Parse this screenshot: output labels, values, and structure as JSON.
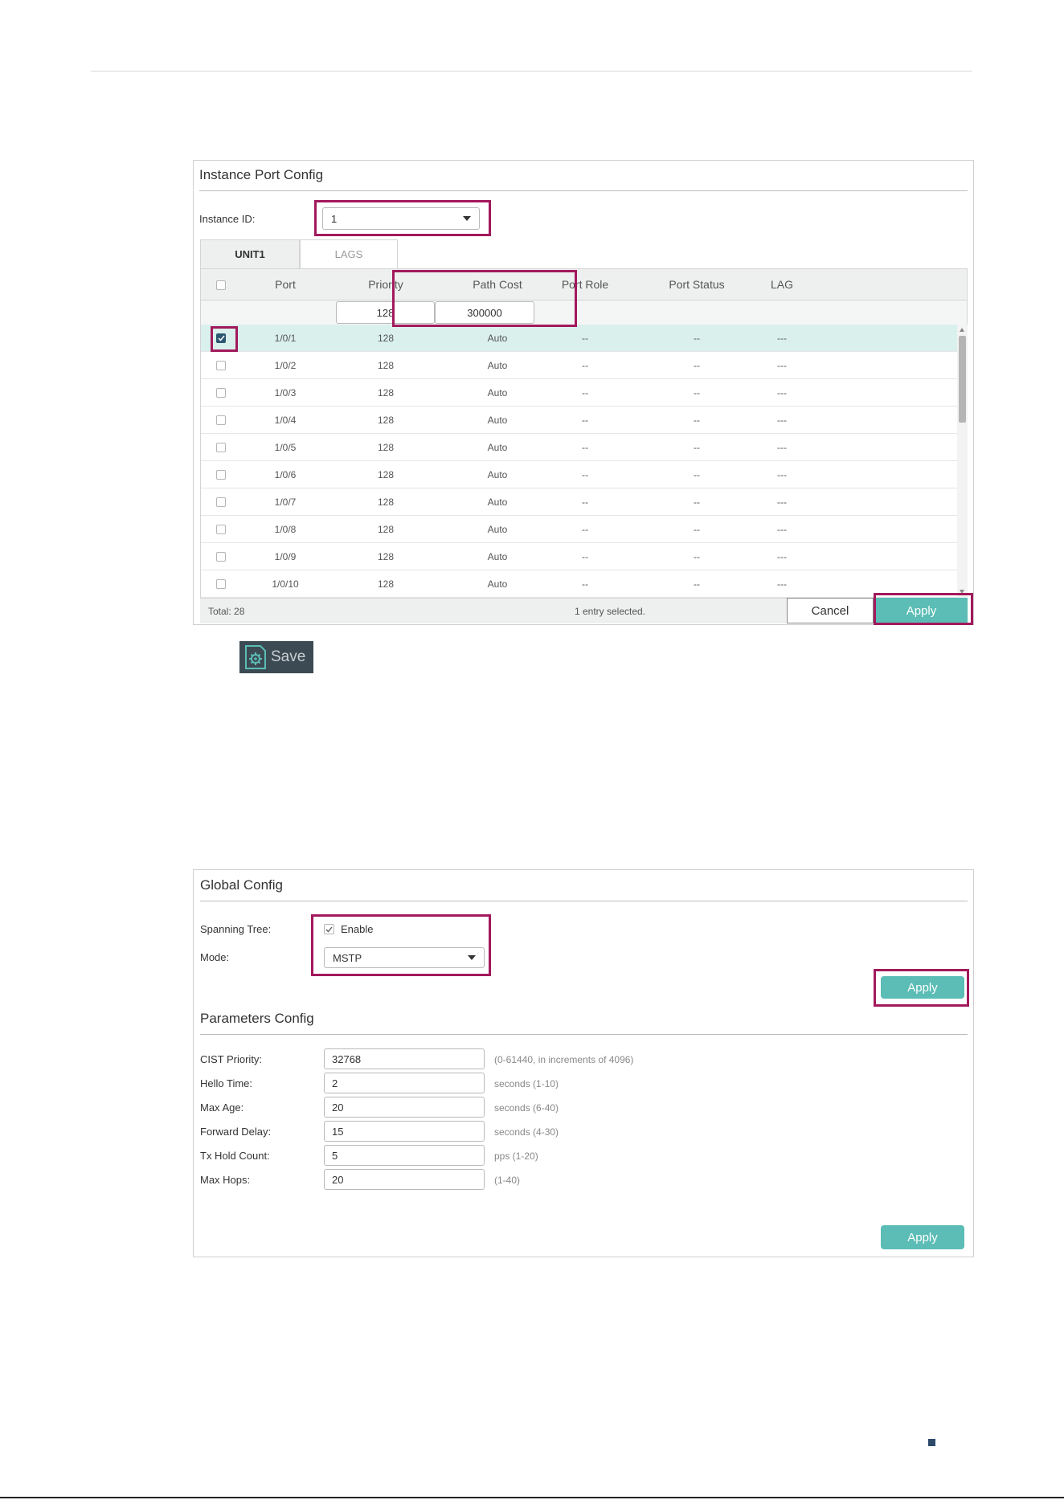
{
  "instance_port_config": {
    "title": "Instance Port Config",
    "instance_id_label": "Instance ID:",
    "instance_id_value": "1",
    "tabs": [
      "UNIT1",
      "LAGS"
    ],
    "columns": [
      "Port",
      "Priority",
      "Path Cost",
      "Port Role",
      "Port Status",
      "LAG"
    ],
    "edit_priority": "128",
    "edit_path_cost": "300000",
    "rows": [
      {
        "port": "1/0/1",
        "priority": "128",
        "path_cost": "Auto",
        "role": "--",
        "status": "--",
        "lag": "---",
        "checked": true
      },
      {
        "port": "1/0/2",
        "priority": "128",
        "path_cost": "Auto",
        "role": "--",
        "status": "--",
        "lag": "---",
        "checked": false
      },
      {
        "port": "1/0/3",
        "priority": "128",
        "path_cost": "Auto",
        "role": "--",
        "status": "--",
        "lag": "---",
        "checked": false
      },
      {
        "port": "1/0/4",
        "priority": "128",
        "path_cost": "Auto",
        "role": "--",
        "status": "--",
        "lag": "---",
        "checked": false
      },
      {
        "port": "1/0/5",
        "priority": "128",
        "path_cost": "Auto",
        "role": "--",
        "status": "--",
        "lag": "---",
        "checked": false
      },
      {
        "port": "1/0/6",
        "priority": "128",
        "path_cost": "Auto",
        "role": "--",
        "status": "--",
        "lag": "---",
        "checked": false
      },
      {
        "port": "1/0/7",
        "priority": "128",
        "path_cost": "Auto",
        "role": "--",
        "status": "--",
        "lag": "---",
        "checked": false
      },
      {
        "port": "1/0/8",
        "priority": "128",
        "path_cost": "Auto",
        "role": "--",
        "status": "--",
        "lag": "---",
        "checked": false
      },
      {
        "port": "1/0/9",
        "priority": "128",
        "path_cost": "Auto",
        "role": "--",
        "status": "--",
        "lag": "---",
        "checked": false
      },
      {
        "port": "1/0/10",
        "priority": "128",
        "path_cost": "Auto",
        "role": "--",
        "status": "--",
        "lag": "---",
        "checked": false
      }
    ],
    "total": "Total: 28",
    "selected_info": "1 entry selected.",
    "cancel_label": "Cancel",
    "apply_label": "Apply"
  },
  "save_button": {
    "label": "Save",
    "icon": "gear-document-icon"
  },
  "global_config": {
    "title": "Global Config",
    "spanning_tree_label": "Spanning Tree:",
    "enable_label": "Enable",
    "enable_checked": true,
    "mode_label": "Mode:",
    "mode_value": "MSTP",
    "apply_label": "Apply"
  },
  "parameters_config": {
    "title": "Parameters Config",
    "fields": [
      {
        "label": "CIST Priority:",
        "value": "32768",
        "hint": "(0-61440, in increments of 4096)"
      },
      {
        "label": "Hello Time:",
        "value": "2",
        "hint": "seconds (1-10)"
      },
      {
        "label": "Max Age:",
        "value": "20",
        "hint": "seconds (6-40)"
      },
      {
        "label": "Forward Delay:",
        "value": "15",
        "hint": "seconds (4-30)"
      },
      {
        "label": "Tx Hold Count:",
        "value": "5",
        "hint": "pps (1-20)"
      },
      {
        "label": "Max Hops:",
        "value": "20",
        "hint": "(1-40)"
      }
    ],
    "apply_label": "Apply"
  },
  "colors": {
    "accent": "#5bbdb5",
    "highlight": "#a2195c",
    "checkbox": "#2c5872",
    "selected_row": "#daf0ec"
  }
}
